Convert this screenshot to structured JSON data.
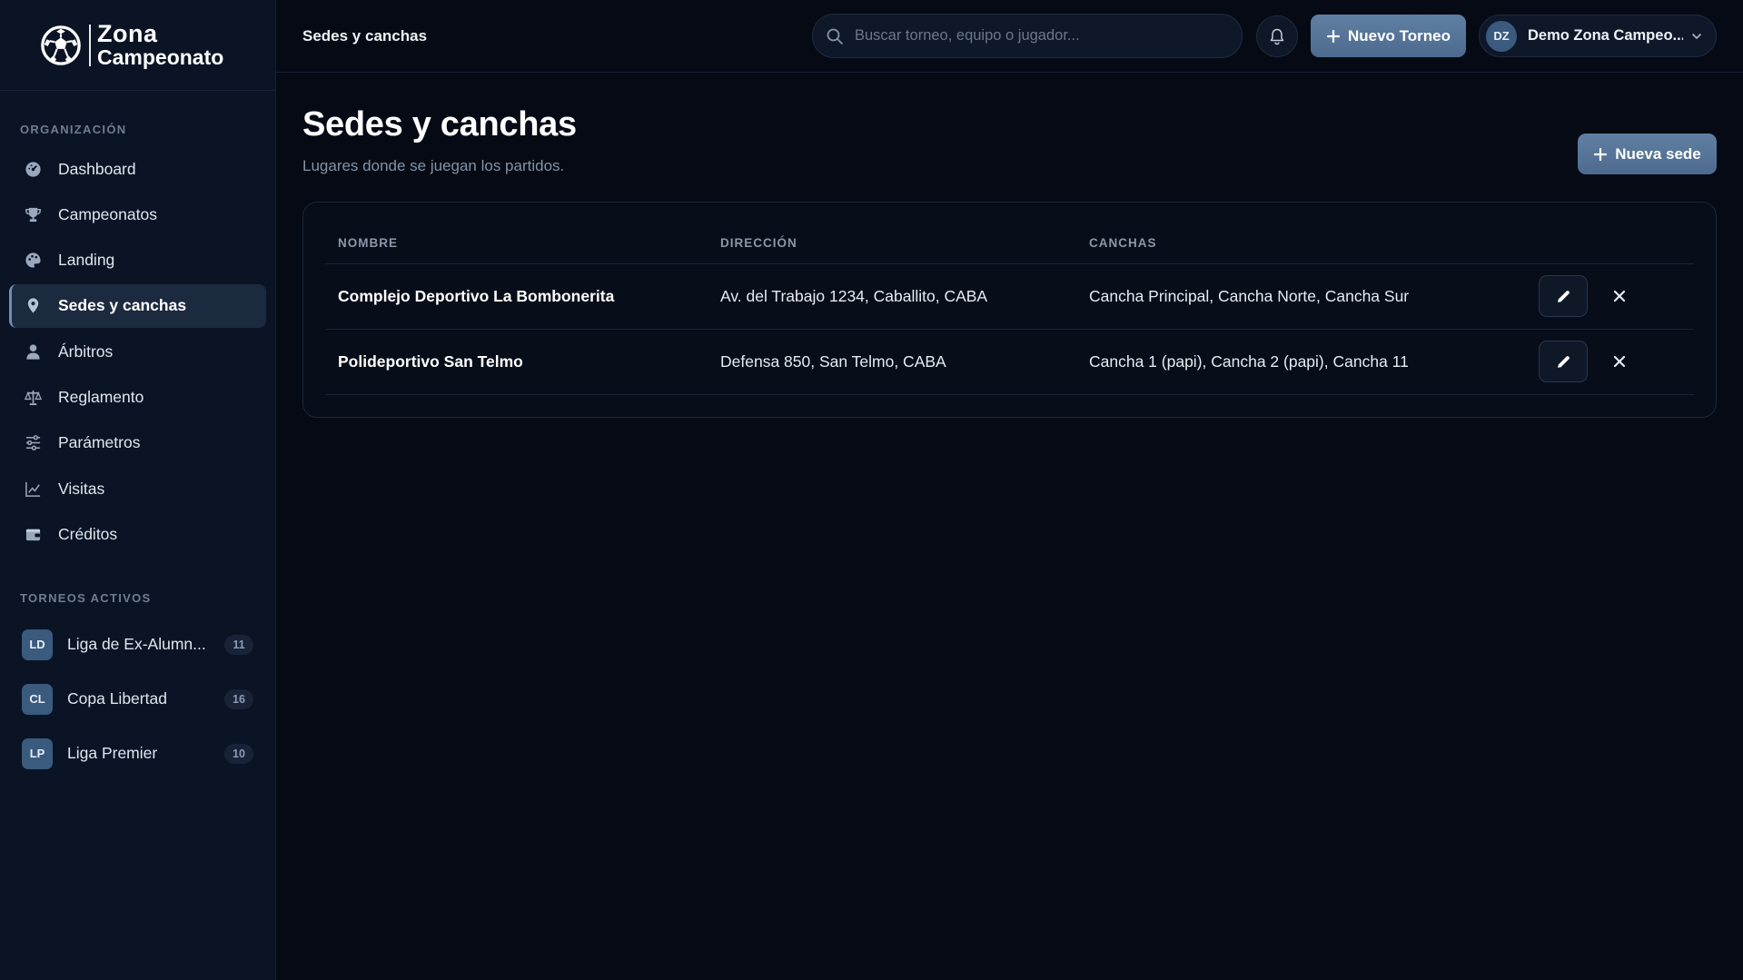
{
  "brand": {
    "line1": "Zona",
    "line2": "Campeonato"
  },
  "sidebar": {
    "org_label": "ORGANIZACIÓN",
    "items": [
      {
        "label": "Dashboard",
        "icon": "dashboard-icon"
      },
      {
        "label": "Campeonatos",
        "icon": "trophy-icon"
      },
      {
        "label": "Landing",
        "icon": "palette-icon"
      },
      {
        "label": "Sedes y canchas",
        "icon": "map-pin-icon",
        "active": true
      },
      {
        "label": "Árbitros",
        "icon": "referee-icon"
      },
      {
        "label": "Reglamento",
        "icon": "scale-icon"
      },
      {
        "label": "Parámetros",
        "icon": "sliders-icon"
      },
      {
        "label": "Visitas",
        "icon": "line-chart-icon"
      },
      {
        "label": "Créditos",
        "icon": "wallet-icon"
      }
    ],
    "active_label": "TORNEOS ACTIVOS",
    "tournaments": [
      {
        "abbr": "LD",
        "name": "Liga de Ex-Alumn...",
        "count": "11"
      },
      {
        "abbr": "CL",
        "name": "Copa Libertad",
        "count": "16"
      },
      {
        "abbr": "LP",
        "name": "Liga Premier",
        "count": "10"
      }
    ]
  },
  "header": {
    "breadcrumb": "Sedes y canchas",
    "search_placeholder": "Buscar torneo, equipo o jugador...",
    "new_tournament_label": "Nuevo Torneo",
    "user_initials": "DZ",
    "user_name": "Demo Zona Campeo..."
  },
  "page": {
    "title": "Sedes y canchas",
    "subtitle": "Lugares donde se juegan los partidos.",
    "new_button_label": "Nueva sede"
  },
  "table": {
    "headers": {
      "name": "NOMBRE",
      "address": "DIRECCIÓN",
      "courts": "CANCHAS"
    },
    "rows": [
      {
        "name": "Complejo Deportivo La Bombonerita",
        "address": "Av. del Trabajo 1234, Caballito, CABA",
        "courts": "Cancha Principal, Cancha Norte, Cancha Sur"
      },
      {
        "name": "Polideportivo San Telmo",
        "address": "Defensa 850, San Telmo, CABA",
        "courts": "Cancha 1 (papi), Cancha 2 (papi), Cancha 11"
      }
    ]
  },
  "colors": {
    "background": "#050a14",
    "sidebar": "#0b1424",
    "accent": "#5a7a9e",
    "active_item": "#1c2a40"
  }
}
